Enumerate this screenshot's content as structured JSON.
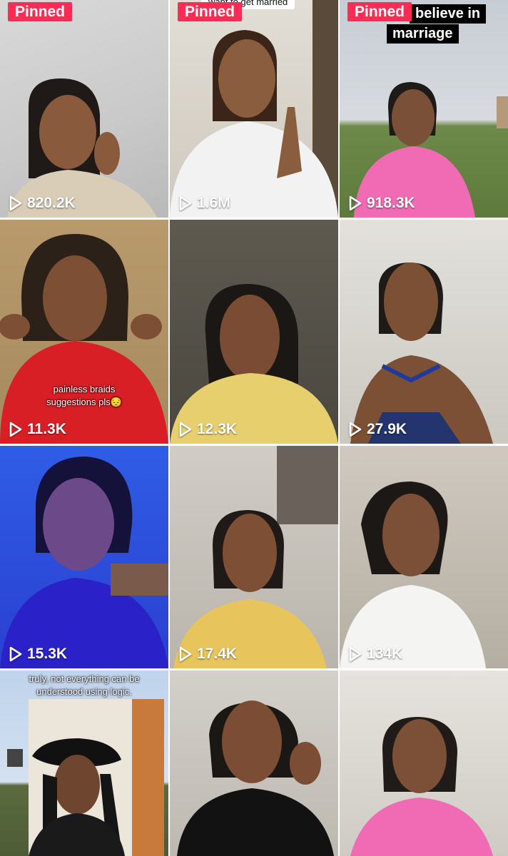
{
  "pinned_label": "Pinned",
  "tiles": [
    {
      "views": "820.2K",
      "pinned": true
    },
    {
      "views": "1.6M",
      "pinned": true,
      "caption": "want to get married"
    },
    {
      "views": "918.3K",
      "pinned": true,
      "caption_line1": "believe in",
      "caption_line2": "marriage"
    },
    {
      "views": "11.3K",
      "overlay_line1": "painless braids",
      "overlay_line2": "suggestions pls😔"
    },
    {
      "views": "12.3K"
    },
    {
      "views": "27.9K"
    },
    {
      "views": "15.3K"
    },
    {
      "views": "17.4K"
    },
    {
      "views": "134K"
    },
    {
      "overlay_line1": "truly, not everything can be",
      "overlay_line2": "understood using logic."
    },
    {},
    {}
  ],
  "colors": {
    "pinned_bg": "#fe2c55",
    "text": "#ffffff"
  },
  "icons": {
    "views": "play-icon"
  }
}
